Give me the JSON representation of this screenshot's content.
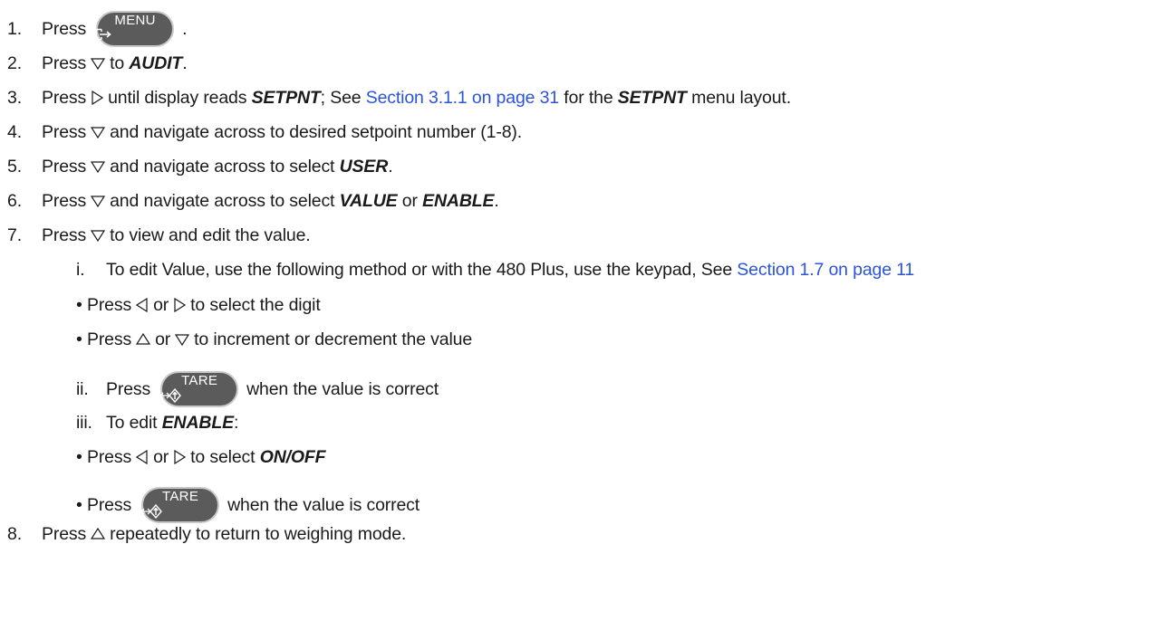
{
  "steps": [
    {
      "num": "1.",
      "press": "Press",
      "end": "."
    },
    {
      "num": "2.",
      "press": "Press",
      "to": "to",
      "kw": "AUDIT",
      "end": "."
    },
    {
      "num": "3.",
      "press": "Press",
      "t1": "until display reads",
      "kw1": "SETPNT",
      "t2": "; See",
      "link": "Section 3.1.1 on page 31",
      "t3": "for the",
      "kw2": "SETPNT",
      "t4": "menu layout."
    },
    {
      "num": "4.",
      "press": "Press",
      "text": "and navigate across to desired setpoint number (1-8)."
    },
    {
      "num": "5.",
      "press": "Press",
      "text": "and navigate across to select",
      "kw": "USER",
      "end": "."
    },
    {
      "num": "6.",
      "press": "Press",
      "text": "and navigate across to select",
      "kw1": "VALUE",
      "or": "or",
      "kw2": "ENABLE",
      "end": "."
    },
    {
      "num": "7.",
      "press": "Press",
      "text": "to view and edit the value."
    },
    {
      "num": "8.",
      "press": "Press",
      "text": "repeatedly to return to weighing mode."
    }
  ],
  "substeps": {
    "i": {
      "num": "i.",
      "text": "To edit Value, use the following method or with the 480 Plus, use the keypad, See",
      "link": "Section 1.7 on page 11"
    },
    "b1": {
      "bullet": "•",
      "press": "Press",
      "or": "or",
      "text": "to select the digit"
    },
    "b2": {
      "bullet": "•",
      "press": "Press",
      "or": "or",
      "text": "to increment or decrement the value"
    },
    "ii": {
      "num": "ii.",
      "press": "Press",
      "text": "when the value is correct"
    },
    "iii": {
      "num": "iii.",
      "text": "To edit",
      "kw": "ENABLE",
      "end": ":"
    },
    "b3": {
      "bullet": "•",
      "press": "Press",
      "or": "or",
      "text": "to select",
      "kw": "ON/OFF"
    },
    "b4": {
      "bullet": "•",
      "press": "Press",
      "text": "when the value is correct"
    }
  },
  "keys": {
    "menu": {
      "label": "MENU",
      "icon": "menu-exit-icon"
    },
    "tare": {
      "label": "TARE",
      "icon": "tare-arrow-icon"
    }
  },
  "colors": {
    "key_fill": "#5b5b5b",
    "link": "#2b54d8",
    "text": "#1a1a1a"
  }
}
